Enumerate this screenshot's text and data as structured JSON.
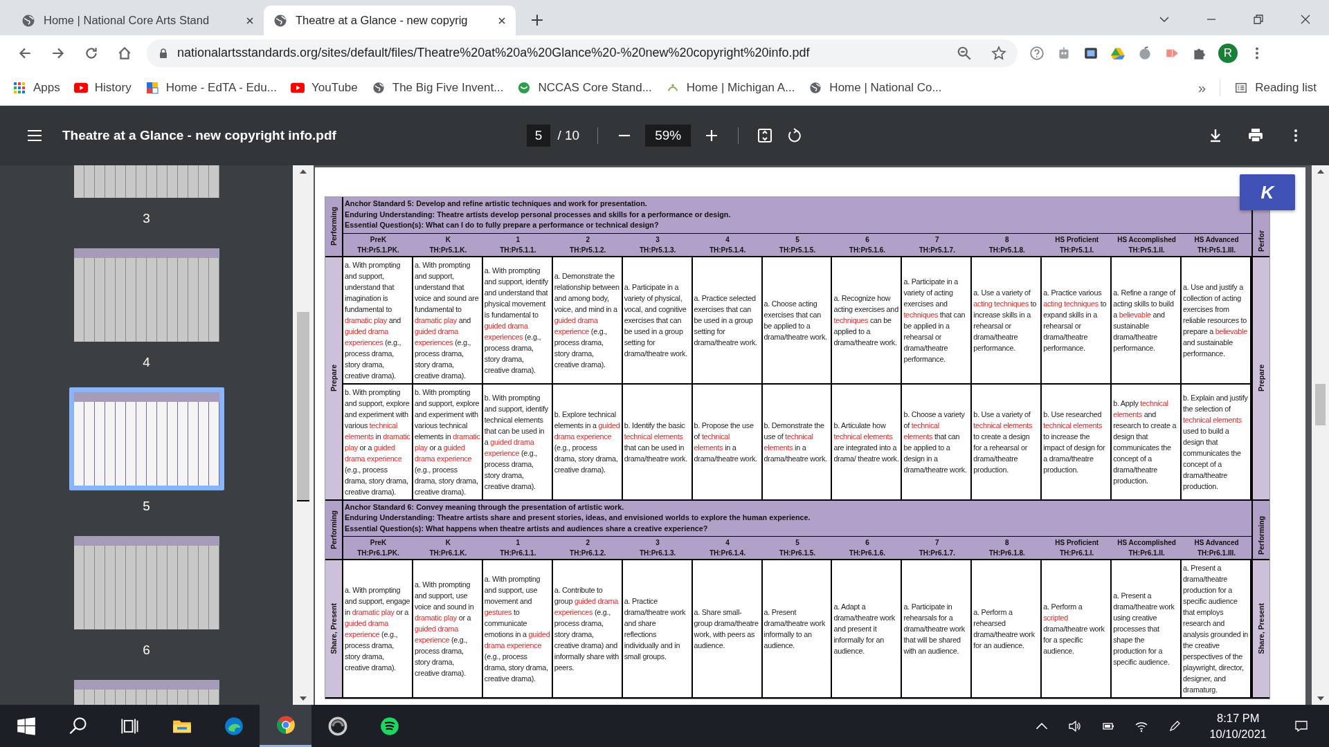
{
  "browser": {
    "tabs": [
      {
        "title": "Home | National Core Arts Stand",
        "selected": false
      },
      {
        "title": "Theatre at a Glance - new copyrig",
        "selected": true
      }
    ],
    "url": "nationalartsstandards.org/sites/default/files/Theatre%20at%20a%20Glance%20-%20new%20copyright%20info.pdf",
    "profile_initial": "R",
    "bookmarks": [
      {
        "kind": "apps",
        "label": "Apps"
      },
      {
        "kind": "video",
        "label": "History"
      },
      {
        "kind": "logo",
        "label": "Home - EdTA - Edu..."
      },
      {
        "kind": "video",
        "label": "YouTube"
      },
      {
        "kind": "globe",
        "label": "The Big Five Invent..."
      },
      {
        "kind": "shield",
        "label": "NCCAS Core Stand..."
      },
      {
        "kind": "small",
        "label": "Home | Michigan A..."
      },
      {
        "kind": "globe",
        "label": "Home | National Co..."
      }
    ],
    "bookmarks_overflow": "»",
    "reading_list": "Reading list"
  },
  "pdf_viewer": {
    "title": "Theatre at a Glance - new copyright info.pdf",
    "page": "5",
    "page_count": "/ 10",
    "zoom": "59%",
    "overlay_button": "K",
    "thumbnails": [
      {
        "page": "3",
        "selected": false
      },
      {
        "page": "4",
        "selected": false
      },
      {
        "page": "5",
        "selected": true
      },
      {
        "page": "6",
        "selected": false
      },
      {
        "selected": false
      }
    ]
  },
  "document": {
    "sections": [
      {
        "side_label": "Performing",
        "side_label_right": "Perfor",
        "process_label": "Prepare",
        "process_label_right": "Prepare",
        "anchor": "Anchor Standard 5: Develop and refine artistic techniques and work for presentation.",
        "enduring": "Enduring Understanding:  Theatre artists develop personal processes and skills for a performance or design.",
        "question": "Essential Question(s): What can I do to fully prepare a performance or technical design?",
        "grades": [
          {
            "grade": "PreK",
            "code": "TH:Pr5.1.PK."
          },
          {
            "grade": "K",
            "code": "TH:Pr5.1.K."
          },
          {
            "grade": "1",
            "code": "TH:Pr5.1.1."
          },
          {
            "grade": "2",
            "code": "TH:Pr5.1.2."
          },
          {
            "grade": "3",
            "code": "TH:Pr5.1.3."
          },
          {
            "grade": "4",
            "code": "TH:Pr5.1.4."
          },
          {
            "grade": "5",
            "code": "TH:Pr5.1.5."
          },
          {
            "grade": "6",
            "code": "TH:Pr5.1.6."
          },
          {
            "grade": "7",
            "code": "TH:Pr5.1.7."
          },
          {
            "grade": "8",
            "code": "TH:Pr5.1.8."
          },
          {
            "grade": "HS Proficient",
            "code": "TH:Pr5.1.I."
          },
          {
            "grade": "HS Accomplished",
            "code": "TH:Pr5.1.II."
          },
          {
            "grade": "HS Advanced",
            "code": "TH:Pr5.1.III."
          }
        ],
        "rows": [
          [
            [
              "a. With prompting and support, understand that imagination is fundamental to ",
              {
                "term": "dramatic play"
              },
              " and ",
              {
                "term": "guided drama experiences"
              },
              " (e.g., process drama, story drama, creative drama)."
            ],
            [
              "a. With prompting and support, understand that voice and sound are fundamental to ",
              {
                "term": "dramatic play"
              },
              " and ",
              {
                "term": "guided drama experiences"
              },
              " (e.g., process drama, story drama, creative drama)."
            ],
            [
              "a. With prompting and support, identify and understand that physical movement is fundamental to ",
              {
                "term": "guided drama experiences"
              },
              " (e.g., process drama, story drama, creative drama)."
            ],
            [
              "a. Demonstrate the relationship between and among body, voice, and mind in a ",
              {
                "term": "guided drama experience"
              },
              " (e.g., process drama, story drama, creative drama)."
            ],
            [
              "a. Participate in a variety of physical, vocal, and cognitive exercises that can be used in a group setting for drama/theatre work."
            ],
            [
              "a. Practice selected exercises that can be used in a group setting for drama/theatre work."
            ],
            [
              "a. Choose acting exercises that can be applied to a drama/theatre work."
            ],
            [
              "a. Recognize how acting exercises and ",
              {
                "term": "techniques"
              },
              " can be applied to a drama/theatre work."
            ],
            [
              "a. Participate in a variety of acting exercises and ",
              {
                "term": "techniques"
              },
              " that can be applied in a rehearsal or drama/theatre performance."
            ],
            [
              "a. Use a variety of ",
              {
                "term": "acting techniques"
              },
              " to increase skills in a rehearsal or drama/theatre performance."
            ],
            [
              "a. Practice various ",
              {
                "term": "acting techniques"
              },
              " to expand skills in a rehearsal or drama/theatre performance."
            ],
            [
              "a. Refine a range of acting skills to build a ",
              {
                "term": "believable"
              },
              " and sustainable drama/theatre performance."
            ],
            [
              "a. Use and justify a collection of acting exercises from reliable resources to prepare a ",
              {
                "term": "believable"
              },
              " and sustainable performance."
            ]
          ],
          [
            [
              "b. With prompting and support, explore and experiment with various ",
              {
                "term": "technical elements"
              },
              " in ",
              {
                "term": "dramatic play"
              },
              " or a ",
              {
                "term": "guided drama experience"
              },
              " (e.g., process drama, story drama, creative drama)."
            ],
            [
              "b. With prompting and support, explore and experiment with various technical elements in ",
              {
                "term": "dramatic play"
              },
              " or a ",
              {
                "term": "guided drama experience"
              },
              " (e.g., process drama, story drama, creative drama)."
            ],
            [
              "b. With prompting and support, identify technical elements that can be used in a ",
              {
                "term": "guided drama experience"
              },
              " (e.g., process drama, story drama, creative drama)."
            ],
            [
              "b. Explore technical elements in a ",
              {
                "term": "guided drama experience"
              },
              " (e.g., process drama, story drama, creative drama)."
            ],
            [
              "b. Identify the basic ",
              {
                "term": "technical elements"
              },
              " that can be used in drama/theatre work."
            ],
            [
              "b. Propose the use of ",
              {
                "term": "technical elements"
              },
              " in a drama/theatre work."
            ],
            [
              "b. Demonstrate the use of ",
              {
                "term": "technical elements"
              },
              " in a drama/theatre work."
            ],
            [
              "b. Articulate how ",
              {
                "term": "technical elements"
              },
              " are integrated into a drama/ theatre work."
            ],
            [
              "b. Choose a variety of ",
              {
                "term": "technical elements"
              },
              " that can be applied to a design in a drama/theatre work."
            ],
            [
              "b. Use a variety of ",
              {
                "term": "technical elements"
              },
              " to create a design for a rehearsal or drama/theatre production."
            ],
            [
              "b. Use researched ",
              {
                "term": "technical elements"
              },
              " to increase the impact of design for a drama/theatre production."
            ],
            [
              "b. Apply ",
              {
                "term": "technical elements"
              },
              " and research to create a design that communicates the concept of a drama/theatre production."
            ],
            [
              "b. Explain and justify the selection of ",
              {
                "term": "technical elements"
              },
              " used to build a design that communicates the concept of a drama/theatre production."
            ]
          ]
        ]
      },
      {
        "side_label": "Performing",
        "side_label_right": "Performing",
        "process_label": "Share, Present",
        "process_label_right": "Share, Present",
        "anchor": "Anchor Standard 6: Convey meaning through the presentation of artistic work.",
        "enduring": "Enduring Understanding:  Theatre artists share and present stories, ideas, and envisioned worlds to explore the human experience.",
        "question": "Essential Question(s): What happens when theatre artists and audiences share a creative experience?",
        "grades": [
          {
            "grade": "PreK",
            "code": "TH:Pr6.1.PK."
          },
          {
            "grade": "K",
            "code": "TH:Pr6.1.K."
          },
          {
            "grade": "1",
            "code": "TH:Pr6.1.1."
          },
          {
            "grade": "2",
            "code": "TH:Pr6.1.2."
          },
          {
            "grade": "3",
            "code": "TH:Pr6.1.3."
          },
          {
            "grade": "4",
            "code": "TH:Pr6.1.4."
          },
          {
            "grade": "5",
            "code": "TH:Pr6.1.5."
          },
          {
            "grade": "6",
            "code": "TH:Pr6.1.6."
          },
          {
            "grade": "7",
            "code": "TH:Pr6.1.7."
          },
          {
            "grade": "8",
            "code": "TH:Pr6.1.8."
          },
          {
            "grade": "HS Proficient",
            "code": "TH:Pr6.1.I."
          },
          {
            "grade": "HS Accomplished",
            "code": "TH:Pr6.1.II."
          },
          {
            "grade": "HS Advanced",
            "code": "TH:Pr6.1.III."
          }
        ],
        "rows": [
          [
            [
              "a. With prompting and support, engage in ",
              {
                "term": "dramatic play"
              },
              " or a ",
              {
                "term": "guided drama experience"
              },
              " (e.g., process drama, story drama, creative drama)."
            ],
            [
              "a. With prompting and support, use voice and sound in ",
              {
                "term": "dramatic play"
              },
              " or a ",
              {
                "term": "guided drama experience"
              },
              " (e.g., process drama, story drama, creative drama)."
            ],
            [
              "a. With prompting and support, use movement and ",
              {
                "term": "gestures"
              },
              " to communicate emotions in a ",
              {
                "term": "guided drama experience"
              },
              " (e.g., process drama, story drama, creative drama)."
            ],
            [
              "a. Contribute to group ",
              {
                "term": "guided drama experiences"
              },
              " (e.g., process drama, story drama, creative drama) and informally share with peers."
            ],
            [
              "a. Practice drama/theatre work and share reflections individually and in small groups."
            ],
            [
              "a. Share small-group drama/theatre work, with peers as audience."
            ],
            [
              "a. Present drama/theatre work informally to an audience."
            ],
            [
              "a. Adapt a drama/theatre work and present it informally for an audience."
            ],
            [
              "a. Participate in rehearsals for a drama/theatre work that will be shared with an audience."
            ],
            [
              "a. Perform a rehearsed drama/theatre work for an audience."
            ],
            [
              "a. Perform a ",
              {
                "term": "scripted"
              },
              " drama/theatre work for a specific audience."
            ],
            [
              "a. Present a drama/theatre work using creative processes that shape the production for a specific audience."
            ],
            [
              "a. Present a drama/theatre production for a specific audience that employs research and analysis grounded in the creative perspectives of the playwright, director, designer, and dramaturg."
            ]
          ]
        ]
      }
    ]
  },
  "taskbar": {
    "apps": [
      {
        "kind": "start",
        "active": false
      },
      {
        "kind": "search",
        "active": false
      },
      {
        "kind": "taskview",
        "active": false
      },
      {
        "kind": "folder",
        "active": false
      },
      {
        "kind": "edge",
        "active": false
      },
      {
        "kind": "chrome",
        "active": true
      },
      {
        "kind": "sync",
        "active": false
      },
      {
        "kind": "music",
        "active": false
      }
    ],
    "time": "8:17 PM",
    "date": "10/10/2021"
  }
}
